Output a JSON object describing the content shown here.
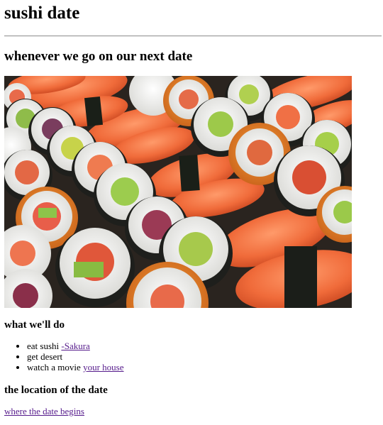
{
  "page": {
    "title": "sushi date",
    "subtitle": "whenever we go on our next date",
    "hero_image": {
      "alt": "assorted sushi platter"
    }
  },
  "plans": {
    "heading": "what we'll do",
    "items": [
      {
        "text": "eat sushi ",
        "link": "-Sakura"
      },
      {
        "text": "get desert",
        "link": ""
      },
      {
        "text": "watch a movie ",
        "link": "your house"
      }
    ]
  },
  "location": {
    "heading": "the location of the date",
    "link": "where the date begins"
  },
  "colors": {
    "visited_link": "#551a8b",
    "rule": "#9a9a9a"
  }
}
